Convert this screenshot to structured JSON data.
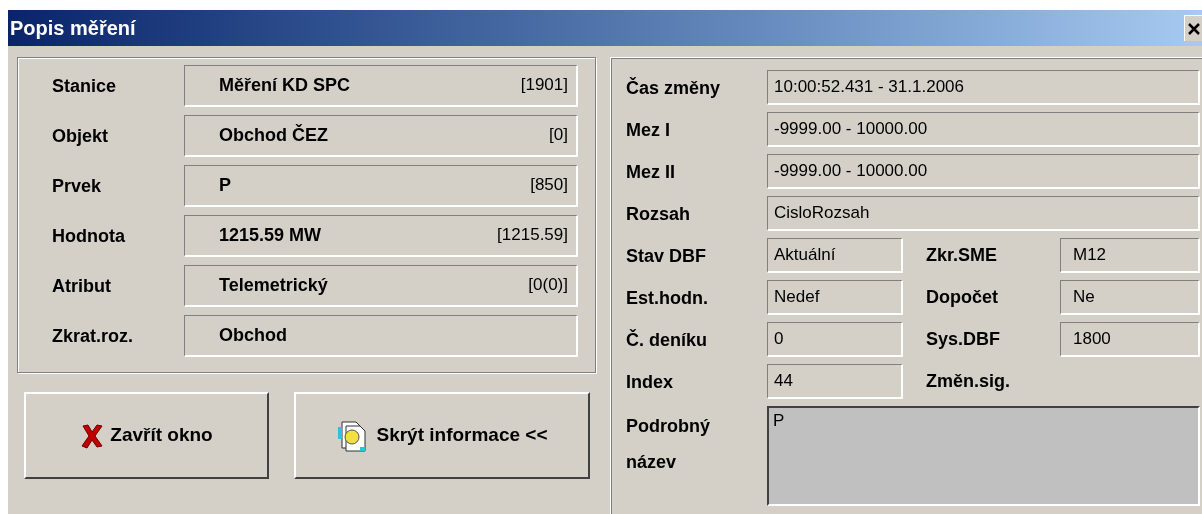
{
  "window": {
    "title": "Popis měření"
  },
  "identity": [
    {
      "label": "Stanice",
      "value": "Měření KD  SPC",
      "code": "[1901]"
    },
    {
      "label": "Objekt",
      "value": "Obchod ČEZ",
      "code": "[0]"
    },
    {
      "label": "Prvek",
      "value": "P",
      "code": "[850]"
    },
    {
      "label": "Hodnota",
      "value": "1215.59 MW",
      "code": "[1215.59]"
    },
    {
      "label": "Atribut",
      "value": "Telemetrický",
      "code": "[0(0)]"
    },
    {
      "label": "Zkrat.roz.",
      "value": "Obchod"
    }
  ],
  "buttons": [
    {
      "kind": "close",
      "label": "Zavřít okno"
    },
    {
      "kind": "hide",
      "label": "Skrýt informace <<"
    }
  ],
  "details": [
    {
      "kind": "wide",
      "label": "Čas změny",
      "value": "10:00:52.431 - 31.1.2006"
    },
    {
      "kind": "wide",
      "label": "Mez I",
      "value": "-9999.00 - 10000.00"
    },
    {
      "kind": "wide",
      "label": "Mez II",
      "value": "-9999.00 - 10000.00"
    },
    {
      "kind": "wide",
      "label": "Rozsah",
      "value": "CisloRozsah"
    },
    {
      "kind": "pair",
      "label": "Stav DBF",
      "value": "Aktuální",
      "label2": "Zkr.SME",
      "value2": "M12"
    },
    {
      "kind": "pair",
      "label": "Est.hodn.",
      "value": "Nedef",
      "label2": "Dopočet",
      "value2": "Ne"
    },
    {
      "kind": "pair",
      "label": "Č. deníku",
      "value": "0",
      "label2": "Sys.DBF",
      "value2": "1800"
    },
    {
      "kind": "pair",
      "label": "Index",
      "value": "44",
      "label2": "Změn.sig."
    },
    {
      "kind": "area",
      "label": "Podrobný název",
      "value": "P"
    }
  ]
}
